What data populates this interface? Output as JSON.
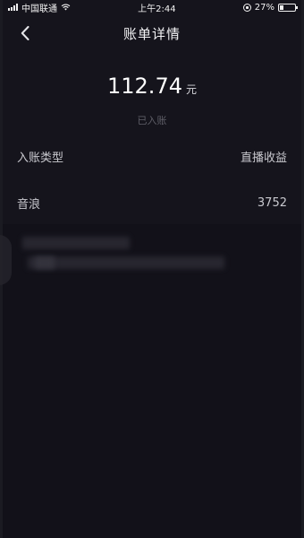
{
  "status_bar": {
    "carrier": "中国联通",
    "time": "上午2:44",
    "battery": "27%",
    "battery_level": 0.27
  },
  "nav": {
    "title": "账单详情",
    "back_icon": "chevron-left-icon"
  },
  "summary": {
    "amount": "112.74",
    "unit": "元",
    "status": "已入账"
  },
  "details": [
    {
      "label": "入账类型",
      "value": "直播收益"
    },
    {
      "label": "音浪",
      "value": "3752"
    }
  ],
  "colors": {
    "background": "#15141c",
    "text_primary": "#ffffff",
    "text_secondary": "#c9c9cf",
    "text_muted": "#5f5f68"
  }
}
